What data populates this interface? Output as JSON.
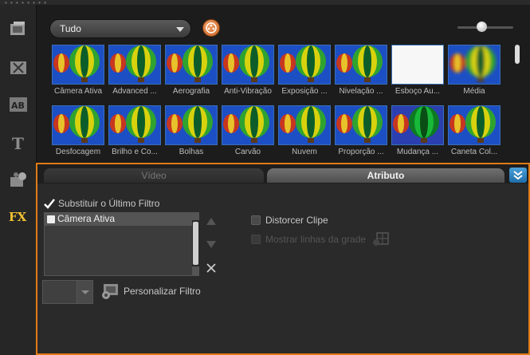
{
  "library": {
    "category_select": "Tudo",
    "row1": [
      {
        "label": "Câmera Ativa",
        "style": "normal"
      },
      {
        "label": "Advanced ...",
        "style": "normal"
      },
      {
        "label": "Aerografia",
        "style": "normal"
      },
      {
        "label": "Anti-Vibração",
        "style": "normal"
      },
      {
        "label": "Exposição ...",
        "style": "normal"
      },
      {
        "label": "Nivelação ...",
        "style": "normal"
      },
      {
        "label": "Esboço Au...",
        "style": "white"
      },
      {
        "label": "Média",
        "style": "blur"
      }
    ],
    "row2": [
      {
        "label": "Desfocagem",
        "style": "normal"
      },
      {
        "label": "Brilho e Co...",
        "style": "normal"
      },
      {
        "label": "Bolhas",
        "style": "normal"
      },
      {
        "label": "Carvão",
        "style": "normal"
      },
      {
        "label": "Nuvem",
        "style": "normal"
      },
      {
        "label": "Proporção ...",
        "style": "normal"
      },
      {
        "label": "Mudança ...",
        "style": "green"
      },
      {
        "label": "Caneta Col...",
        "style": "normal"
      }
    ]
  },
  "panel": {
    "tab_video": "Vídeo",
    "tab_attribute": "Atributo",
    "replace_last_filter": "Substituir o Último Filtro",
    "applied_filters": [
      "Câmera Ativa"
    ],
    "distort_clip": "Distorcer Clipe",
    "show_grid": "Mostrar linhas da grade",
    "customize_filter": "Personalizar Filtro"
  },
  "colors": {
    "accent_border": "#e07c16",
    "sidebar_fx": "#f2c230"
  }
}
